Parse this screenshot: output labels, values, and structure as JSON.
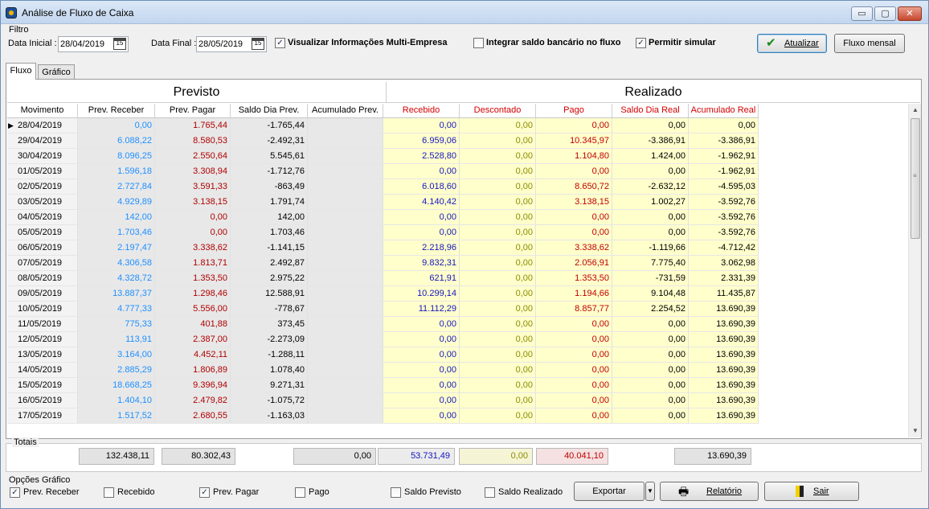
{
  "window": {
    "title": "Análise de Fluxo de Caixa",
    "minimize": "▭",
    "maximize": "▢",
    "close": "✕"
  },
  "filter": {
    "group_label": "Filtro",
    "date_start_label": "Data Inicial :",
    "date_start_value": "28/04/2019",
    "date_end_label": "Data Final :",
    "date_end_value": "28/05/2019",
    "calendar_glyph": "15",
    "multi_empresa_label": "Visualizar Informações Multi-Empresa",
    "multi_empresa_checked": true,
    "integrar_label": "Integrar saldo bancário no fluxo",
    "integrar_checked": false,
    "simular_label": "Permitir simular",
    "simular_checked": true,
    "atualizar_label": "Atualizar",
    "fluxo_mensal_label": "Fluxo mensal"
  },
  "tabs": [
    {
      "label": "Fluxo",
      "active": true
    },
    {
      "label": "Gráfico",
      "active": false
    }
  ],
  "sections": {
    "previsto": "Previsto",
    "realizado": "Realizado"
  },
  "columns": [
    "Movimento",
    "Prev. Receber",
    "Prev. Pagar",
    "Saldo Dia Prev.",
    "Acumulado Prev.",
    "Recebido",
    "Descontado",
    "Pago",
    "Saldo Dia Real",
    "Acumulado Real"
  ],
  "rows": [
    [
      "28/04/2019",
      "0,00",
      "1.765,44",
      "-1.765,44",
      "",
      "0,00",
      "0,00",
      "0,00",
      "0,00",
      "0,00"
    ],
    [
      "29/04/2019",
      "6.088,22",
      "8.580,53",
      "-2.492,31",
      "",
      "6.959,06",
      "0,00",
      "10.345,97",
      "-3.386,91",
      "-3.386,91"
    ],
    [
      "30/04/2019",
      "8.096,25",
      "2.550,64",
      "5.545,61",
      "",
      "2.528,80",
      "0,00",
      "1.104,80",
      "1.424,00",
      "-1.962,91"
    ],
    [
      "01/05/2019",
      "1.596,18",
      "3.308,94",
      "-1.712,76",
      "",
      "0,00",
      "0,00",
      "0,00",
      "0,00",
      "-1.962,91"
    ],
    [
      "02/05/2019",
      "2.727,84",
      "3.591,33",
      "-863,49",
      "",
      "6.018,60",
      "0,00",
      "8.650,72",
      "-2.632,12",
      "-4.595,03"
    ],
    [
      "03/05/2019",
      "4.929,89",
      "3.138,15",
      "1.791,74",
      "",
      "4.140,42",
      "0,00",
      "3.138,15",
      "1.002,27",
      "-3.592,76"
    ],
    [
      "04/05/2019",
      "142,00",
      "0,00",
      "142,00",
      "",
      "0,00",
      "0,00",
      "0,00",
      "0,00",
      "-3.592,76"
    ],
    [
      "05/05/2019",
      "1.703,46",
      "0,00",
      "1.703,46",
      "",
      "0,00",
      "0,00",
      "0,00",
      "0,00",
      "-3.592,76"
    ],
    [
      "06/05/2019",
      "2.197,47",
      "3.338,62",
      "-1.141,15",
      "",
      "2.218,96",
      "0,00",
      "3.338,62",
      "-1.119,66",
      "-4.712,42"
    ],
    [
      "07/05/2019",
      "4.306,58",
      "1.813,71",
      "2.492,87",
      "",
      "9.832,31",
      "0,00",
      "2.056,91",
      "7.775,40",
      "3.062,98"
    ],
    [
      "08/05/2019",
      "4.328,72",
      "1.353,50",
      "2.975,22",
      "",
      "621,91",
      "0,00",
      "1.353,50",
      "-731,59",
      "2.331,39"
    ],
    [
      "09/05/2019",
      "13.887,37",
      "1.298,46",
      "12.588,91",
      "",
      "10.299,14",
      "0,00",
      "1.194,66",
      "9.104,48",
      "11.435,87"
    ],
    [
      "10/05/2019",
      "4.777,33",
      "5.556,00",
      "-778,67",
      "",
      "11.112,29",
      "0,00",
      "8.857,77",
      "2.254,52",
      "13.690,39"
    ],
    [
      "11/05/2019",
      "775,33",
      "401,88",
      "373,45",
      "",
      "0,00",
      "0,00",
      "0,00",
      "0,00",
      "13.690,39"
    ],
    [
      "12/05/2019",
      "113,91",
      "2.387,00",
      "-2.273,09",
      "",
      "0,00",
      "0,00",
      "0,00",
      "0,00",
      "13.690,39"
    ],
    [
      "13/05/2019",
      "3.164,00",
      "4.452,11",
      "-1.288,11",
      "",
      "0,00",
      "0,00",
      "0,00",
      "0,00",
      "13.690,39"
    ],
    [
      "14/05/2019",
      "2.885,29",
      "1.806,89",
      "1.078,40",
      "",
      "0,00",
      "0,00",
      "0,00",
      "0,00",
      "13.690,39"
    ],
    [
      "15/05/2019",
      "18.668,25",
      "9.396,94",
      "9.271,31",
      "",
      "0,00",
      "0,00",
      "0,00",
      "0,00",
      "13.690,39"
    ],
    [
      "16/05/2019",
      "1.404,10",
      "2.479,82",
      "-1.075,72",
      "",
      "0,00",
      "0,00",
      "0,00",
      "0,00",
      "13.690,39"
    ],
    [
      "17/05/2019",
      "1.517,52",
      "2.680,55",
      "-1.163,03",
      "",
      "0,00",
      "0,00",
      "0,00",
      "0,00",
      "13.690,39"
    ]
  ],
  "current_row_marker": "▶",
  "totals": {
    "label": "Totais",
    "prev_receber": "132.438,11",
    "prev_pagar": "80.302,43",
    "acumulado_prev": "0,00",
    "recebido": "53.731,49",
    "descontado": "0,00",
    "pago": "40.041,10",
    "acumulado_real": "13.690,39"
  },
  "chart_options": {
    "label": "Opções Gráfico",
    "items": [
      {
        "label": "Prev. Receber",
        "checked": true
      },
      {
        "label": "Recebido",
        "checked": false
      },
      {
        "label": "Prev. Pagar",
        "checked": true
      },
      {
        "label": "Pago",
        "checked": false
      },
      {
        "label": "Saldo Previsto",
        "checked": false
      },
      {
        "label": "Saldo Realizado",
        "checked": false
      }
    ]
  },
  "actions": {
    "exportar": "Exportar",
    "relatorio": "Relatório",
    "sair": "Sair"
  },
  "colors": {
    "prev_receber": "#1e8fff",
    "prev_pagar": "#b00000",
    "recebido": "#1515c0",
    "descontado": "#8c8c00",
    "pago": "#c00000",
    "realizado_header": "#d40000",
    "realizado_bg": "#ffffcc",
    "previsto_bg": "#e8e8e8"
  }
}
